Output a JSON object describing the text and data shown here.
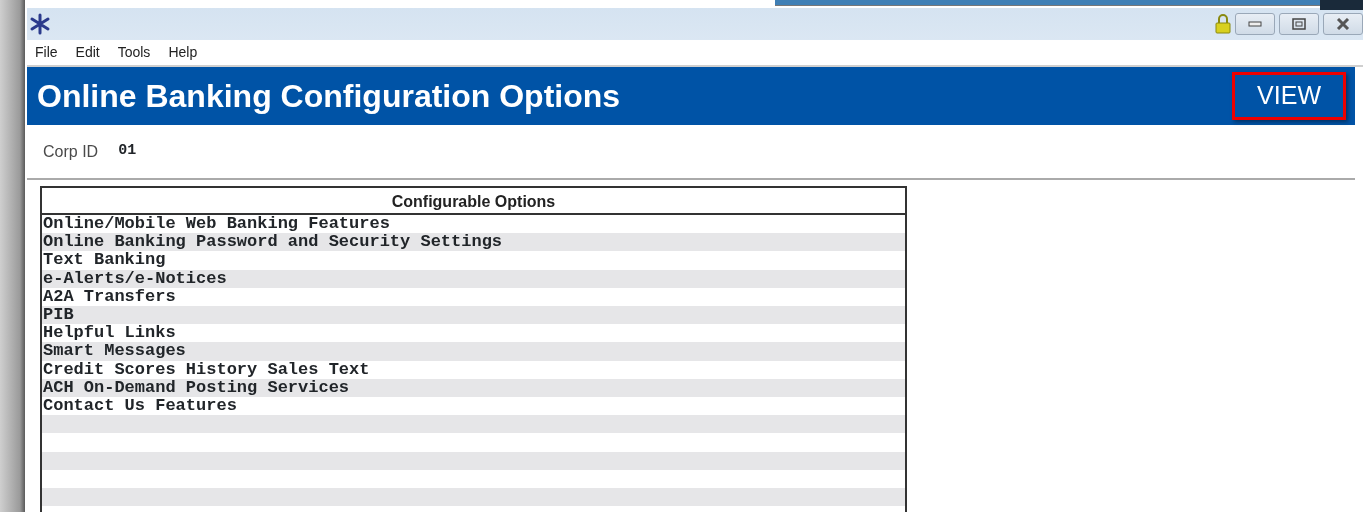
{
  "menu": [
    "File",
    "Edit",
    "Tools",
    "Help"
  ],
  "header": {
    "title": "Online Banking Configuration Options",
    "mode": "VIEW"
  },
  "corp": {
    "label": "Corp ID",
    "value": "01"
  },
  "table": {
    "heading": "Configurable Options",
    "rows": [
      "Online/Mobile Web Banking Features",
      "Online Banking Password and Security Settings",
      "Text Banking",
      "e-Alerts/e-Notices",
      "A2A Transfers",
      "PIB",
      "Helpful Links",
      "Smart Messages",
      "Credit Scores History Sales Text",
      "ACH On-Demand Posting Services",
      "Contact Us Features"
    ]
  }
}
